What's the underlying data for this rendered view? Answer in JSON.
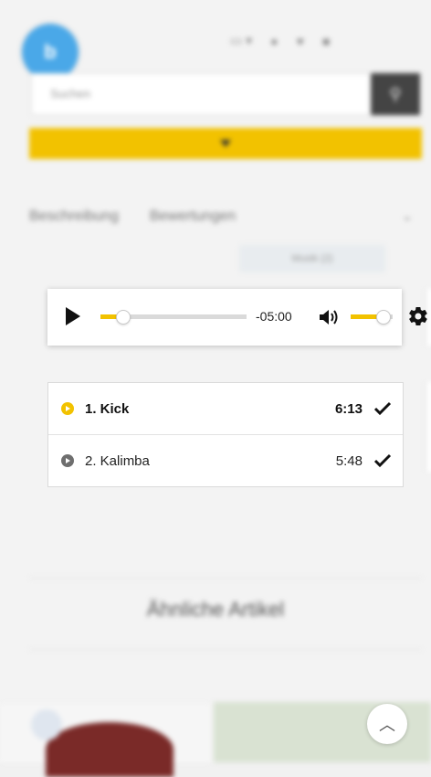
{
  "header": {
    "logo_letter": "b",
    "search_placeholder": "Suchen"
  },
  "tabs": {
    "items": [
      "Beschreibung",
      "Bewertungen"
    ],
    "pill_label": "Musik (2)"
  },
  "player": {
    "progress": 0.15,
    "volume": 0.75,
    "time_remaining": "-05:00"
  },
  "playlist": {
    "tracks": [
      {
        "title": "1. Kick",
        "duration": "6:13",
        "active": true
      },
      {
        "title": "2. Kalimba",
        "duration": "5:48",
        "active": false
      }
    ]
  },
  "similar": {
    "heading": "Ähnliche Artikel"
  },
  "colors": {
    "accent": "#f2c200",
    "logo": "#4aa8e8",
    "inactive_icon": "#6e6e6e"
  },
  "icons": [
    "search-icon",
    "user-icon",
    "heart-icon",
    "cart-icon",
    "play-icon",
    "volume-icon",
    "gear-icon",
    "checkmark-icon",
    "chevron-up-icon"
  ]
}
